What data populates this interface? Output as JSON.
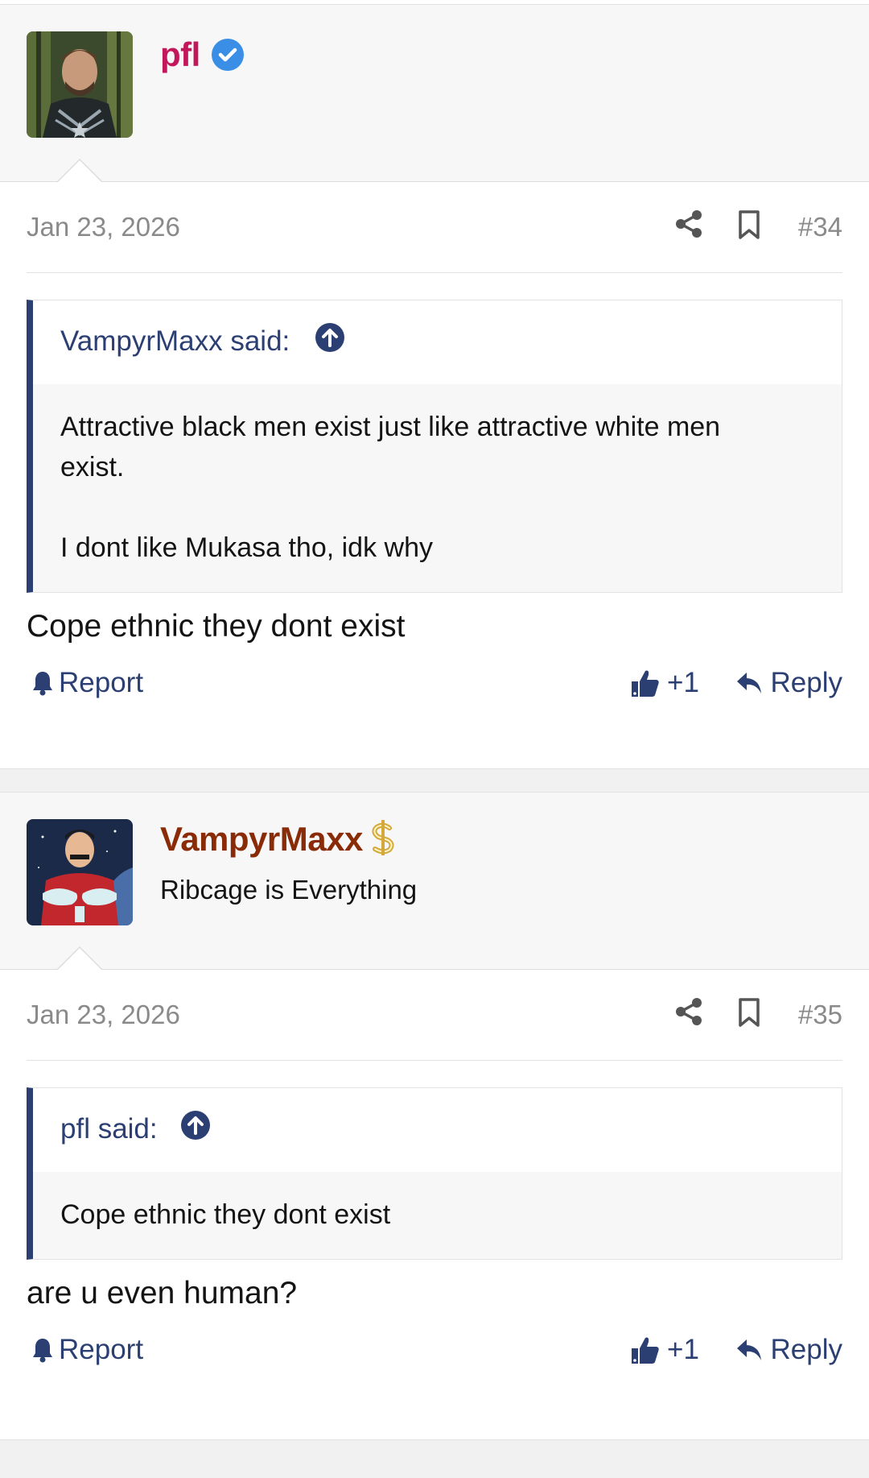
{
  "posts": [
    {
      "username": "pfl",
      "username_color": "#c2185b",
      "user_title": "",
      "badge": "verified-check-icon",
      "date": "Jan 23, 2026",
      "number": "#34",
      "quote": {
        "author": "VampyrMaxx said:",
        "lines": [
          "Attractive black men exist just like attractive white men",
          "exist.",
          "I dont like Mukasa tho, idk why"
        ]
      },
      "text": "Cope ethnic they dont exist",
      "actions": {
        "report": "Report",
        "like": "+1",
        "reply": "Reply"
      }
    },
    {
      "username": "VampyrMaxx",
      "username_color": "#8a2b07",
      "user_title": "Ribcage is Everything",
      "badge": "dollar-icon",
      "date": "Jan 23, 2026",
      "number": "#35",
      "quote": {
        "author": "pfl said:",
        "lines": [
          "Cope ethnic they dont exist"
        ]
      },
      "text": "are u even human?",
      "actions": {
        "report": "Report",
        "like": "+1",
        "reply": "Reply"
      }
    }
  ],
  "colors": {
    "accent": "#2b3f73",
    "meta_text": "#8a8a8a",
    "verified": "#3a8ee6"
  }
}
